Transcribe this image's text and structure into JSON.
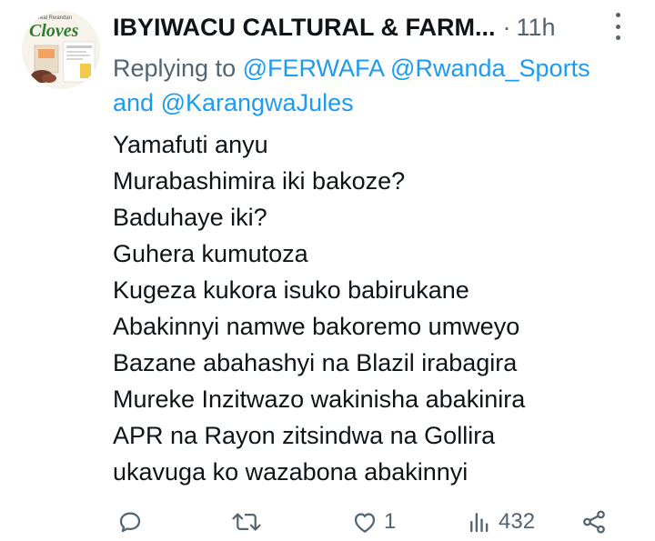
{
  "tweet": {
    "author_name": "IBYIWACU CALTURAL & FARM...",
    "separator": "·",
    "time": "11h",
    "reply_prefix": "Replying to ",
    "mentions": [
      "@FERWAFA",
      "@Rwanda_Sports",
      "@KarangwaJules"
    ],
    "and_word": "and",
    "body_lines": [
      "Yamafuti anyu",
      "Murabashimira iki bakoze?",
      "Baduhaye iki?",
      "Guhera kumutoza",
      "Kugeza kukora isuko babirukane",
      "Abakinnyi namwe bakoremo umweyo",
      "Bazane abahashyi na Blazil irabagira",
      "Mureke Inzitwazo wakinisha abakinira",
      "APR na Rayon zitsindwa na Gollira",
      "ukavuga ko wazabona abakinnyi"
    ]
  },
  "avatar": {
    "logo_text": "Cloves",
    "tagline": "The real Rwandan",
    "brand_color": "#2e7d32"
  },
  "actions": {
    "reply_icon": "reply-icon",
    "retweet_icon": "retweet-icon",
    "like_icon": "like-icon",
    "like_count": "1",
    "views_icon": "views-icon",
    "views_count": "432",
    "share_icon": "share-icon"
  },
  "colors": {
    "text": "#0f1419",
    "muted": "#536471",
    "link": "#1d9bf0"
  }
}
